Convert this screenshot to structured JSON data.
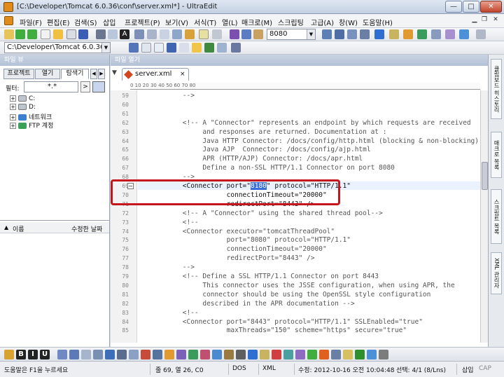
{
  "window": {
    "title": "[C:\\Developer\\Tomcat 6.0.36\\conf\\server.xml*] - UltraEdit",
    "min": "—",
    "max": "□",
    "close": "✕"
  },
  "menu": [
    "파일(F)",
    "편집(E)",
    "검색(S)",
    "삽입",
    "프로젝트(P)",
    "보기(V)",
    "서식(T)",
    "열(L)",
    "매크로(M)",
    "스크립팅",
    "고급(A)",
    "창(W)",
    "도움말(H)"
  ],
  "toolbar": {
    "port_combo": "8080",
    "path_combo": "C:\\Developer\\Tomcat 6.0.36\\c"
  },
  "left_pane": {
    "header": "파일 뷰",
    "tabs": [
      "프로젝트",
      "열기",
      "탐색기"
    ],
    "filter_label": "필터:",
    "filter_value": "*.*",
    "tree": [
      {
        "label": "C:"
      },
      {
        "label": "D:"
      },
      {
        "label": "네트워크"
      },
      {
        "label": "FTP 계정"
      }
    ],
    "list_col_name": "이름",
    "list_col_modified": "수정한 날짜"
  },
  "editor": {
    "header": "파일 열기",
    "file_tab": "server.xml",
    "ruler": "0         10        20        30        40        50        60        70        80",
    "lines": [
      {
        "n": "59",
        "text": "        -->",
        "cls": "cmt"
      },
      {
        "n": "60",
        "text": "",
        "cls": ""
      },
      {
        "n": "61",
        "text": "",
        "cls": ""
      },
      {
        "n": "62",
        "text": "        <!-- A \"Connector\" represents an endpoint by which requests are received",
        "cls": "cmt"
      },
      {
        "n": "63",
        "text": "             and responses are returned. Documentation at :",
        "cls": "cmt"
      },
      {
        "n": "64",
        "text": "             Java HTTP Connector: /docs/config/http.html (blocking & non-blocking)",
        "cls": "cmt"
      },
      {
        "n": "65",
        "text": "             Java AJP  Connector: /docs/config/ajp.html",
        "cls": "cmt"
      },
      {
        "n": "66",
        "text": "             APR (HTTP/AJP) Connector: /docs/apr.html",
        "cls": "cmt"
      },
      {
        "n": "67",
        "text": "             Define a non-SSL HTTP/1.1 Connector on port 8080",
        "cls": "cmt"
      },
      {
        "n": "68",
        "text": "        -->",
        "cls": "cmt"
      },
      {
        "n": "69",
        "text": "",
        "cls": ""
      },
      {
        "n": "70",
        "text": "                   connectionTimeout=\"20000\"",
        "cls": ""
      },
      {
        "n": "71",
        "text": "                   redirectPort=\"8443\" />",
        "cls": ""
      },
      {
        "n": "72",
        "text": "        <!-- A \"Connector\" using the shared thread pool-->",
        "cls": "cmt"
      },
      {
        "n": "73",
        "text": "        <!--",
        "cls": "cmt"
      },
      {
        "n": "74",
        "text": "        <Connector executor=\"tomcatThreadPool\"",
        "cls": "cmt"
      },
      {
        "n": "75",
        "text": "                   port=\"8080\" protocol=\"HTTP/1.1\"",
        "cls": "cmt"
      },
      {
        "n": "76",
        "text": "                   connectionTimeout=\"20000\"",
        "cls": "cmt"
      },
      {
        "n": "77",
        "text": "                   redirectPort=\"8443\" />",
        "cls": "cmt"
      },
      {
        "n": "78",
        "text": "        -->",
        "cls": "cmt"
      },
      {
        "n": "79",
        "text": "        <!-- Define a SSL HTTP/1.1 Connector on port 8443",
        "cls": "cmt"
      },
      {
        "n": "80",
        "text": "             This connector uses the JSSE configuration, when using APR, the",
        "cls": "cmt"
      },
      {
        "n": "81",
        "text": "             connector should be using the OpenSSL style configuration",
        "cls": "cmt"
      },
      {
        "n": "82",
        "text": "             described in the APR documentation -->",
        "cls": "cmt"
      },
      {
        "n": "83",
        "text": "        <!--",
        "cls": "cmt"
      },
      {
        "n": "84",
        "text": "        <Connector port=\"8443\" protocol=\"HTTP/1.1\" SSLEnabled=\"true\"",
        "cls": "cmt"
      },
      {
        "n": "85",
        "text": "                   maxThreads=\"150\" scheme=\"https\" secure=\"true\"",
        "cls": "cmt"
      }
    ],
    "line69_pre": "        <Connector port=\"",
    "line69_sel": "8180",
    "line69_post": "\" protocol=\"HTTP/1.1\""
  },
  "right_tabs": [
    "클립보드 히스토리",
    "매크로 목록",
    "스크립트 목록",
    "XML 관리자"
  ],
  "status": {
    "help": "도움말은 F1을 누르세요",
    "position": "줄 69, 열 26, C0",
    "lineend": "DOS",
    "syntax": "XML",
    "modified": "수정: 2012-10-16 오전 10:04:48",
    "selection": "선택: 4/1 (8/Lns)",
    "insert": "삽입",
    "caps": "CAP"
  },
  "colors": {
    "highlight_box": "#c4161c",
    "selection": "#3a6fd8"
  }
}
